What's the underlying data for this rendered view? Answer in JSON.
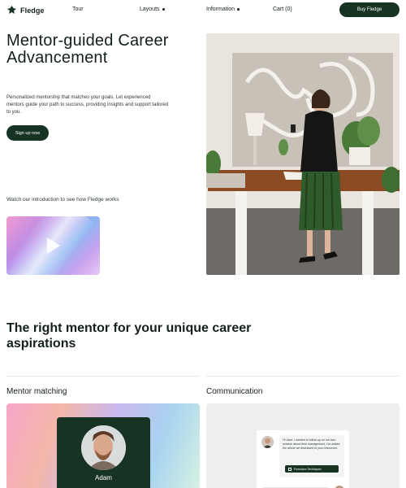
{
  "nav": {
    "brand": "Fledge",
    "links": [
      "Tour",
      "Layouts",
      "Information",
      "Cart (0)"
    ],
    "cta": "Buy Fledge"
  },
  "hero": {
    "title": "Mentor-guided Career Advancement",
    "description": "Personalized mentorship that matches your goals. Let experienced mentors guide your path to success, providing insights and support tailored to you.",
    "signup": "Sign up now",
    "video_caption": "Watch our introduction to see how Fledge works"
  },
  "section": {
    "title": "The right mentor for your unique career aspirations",
    "features": [
      {
        "label": "Mentor matching"
      },
      {
        "label": "Communication"
      }
    ]
  },
  "mentor_card": {
    "name": "Adam"
  },
  "chat": {
    "message": "Hi Jane, I wanted to follow up on our last session about time management. I've added the article we discussed to your resources.",
    "chip": "Pomodoro Techniques"
  },
  "colors": {
    "primary": "#163324",
    "text": "#13201b"
  }
}
